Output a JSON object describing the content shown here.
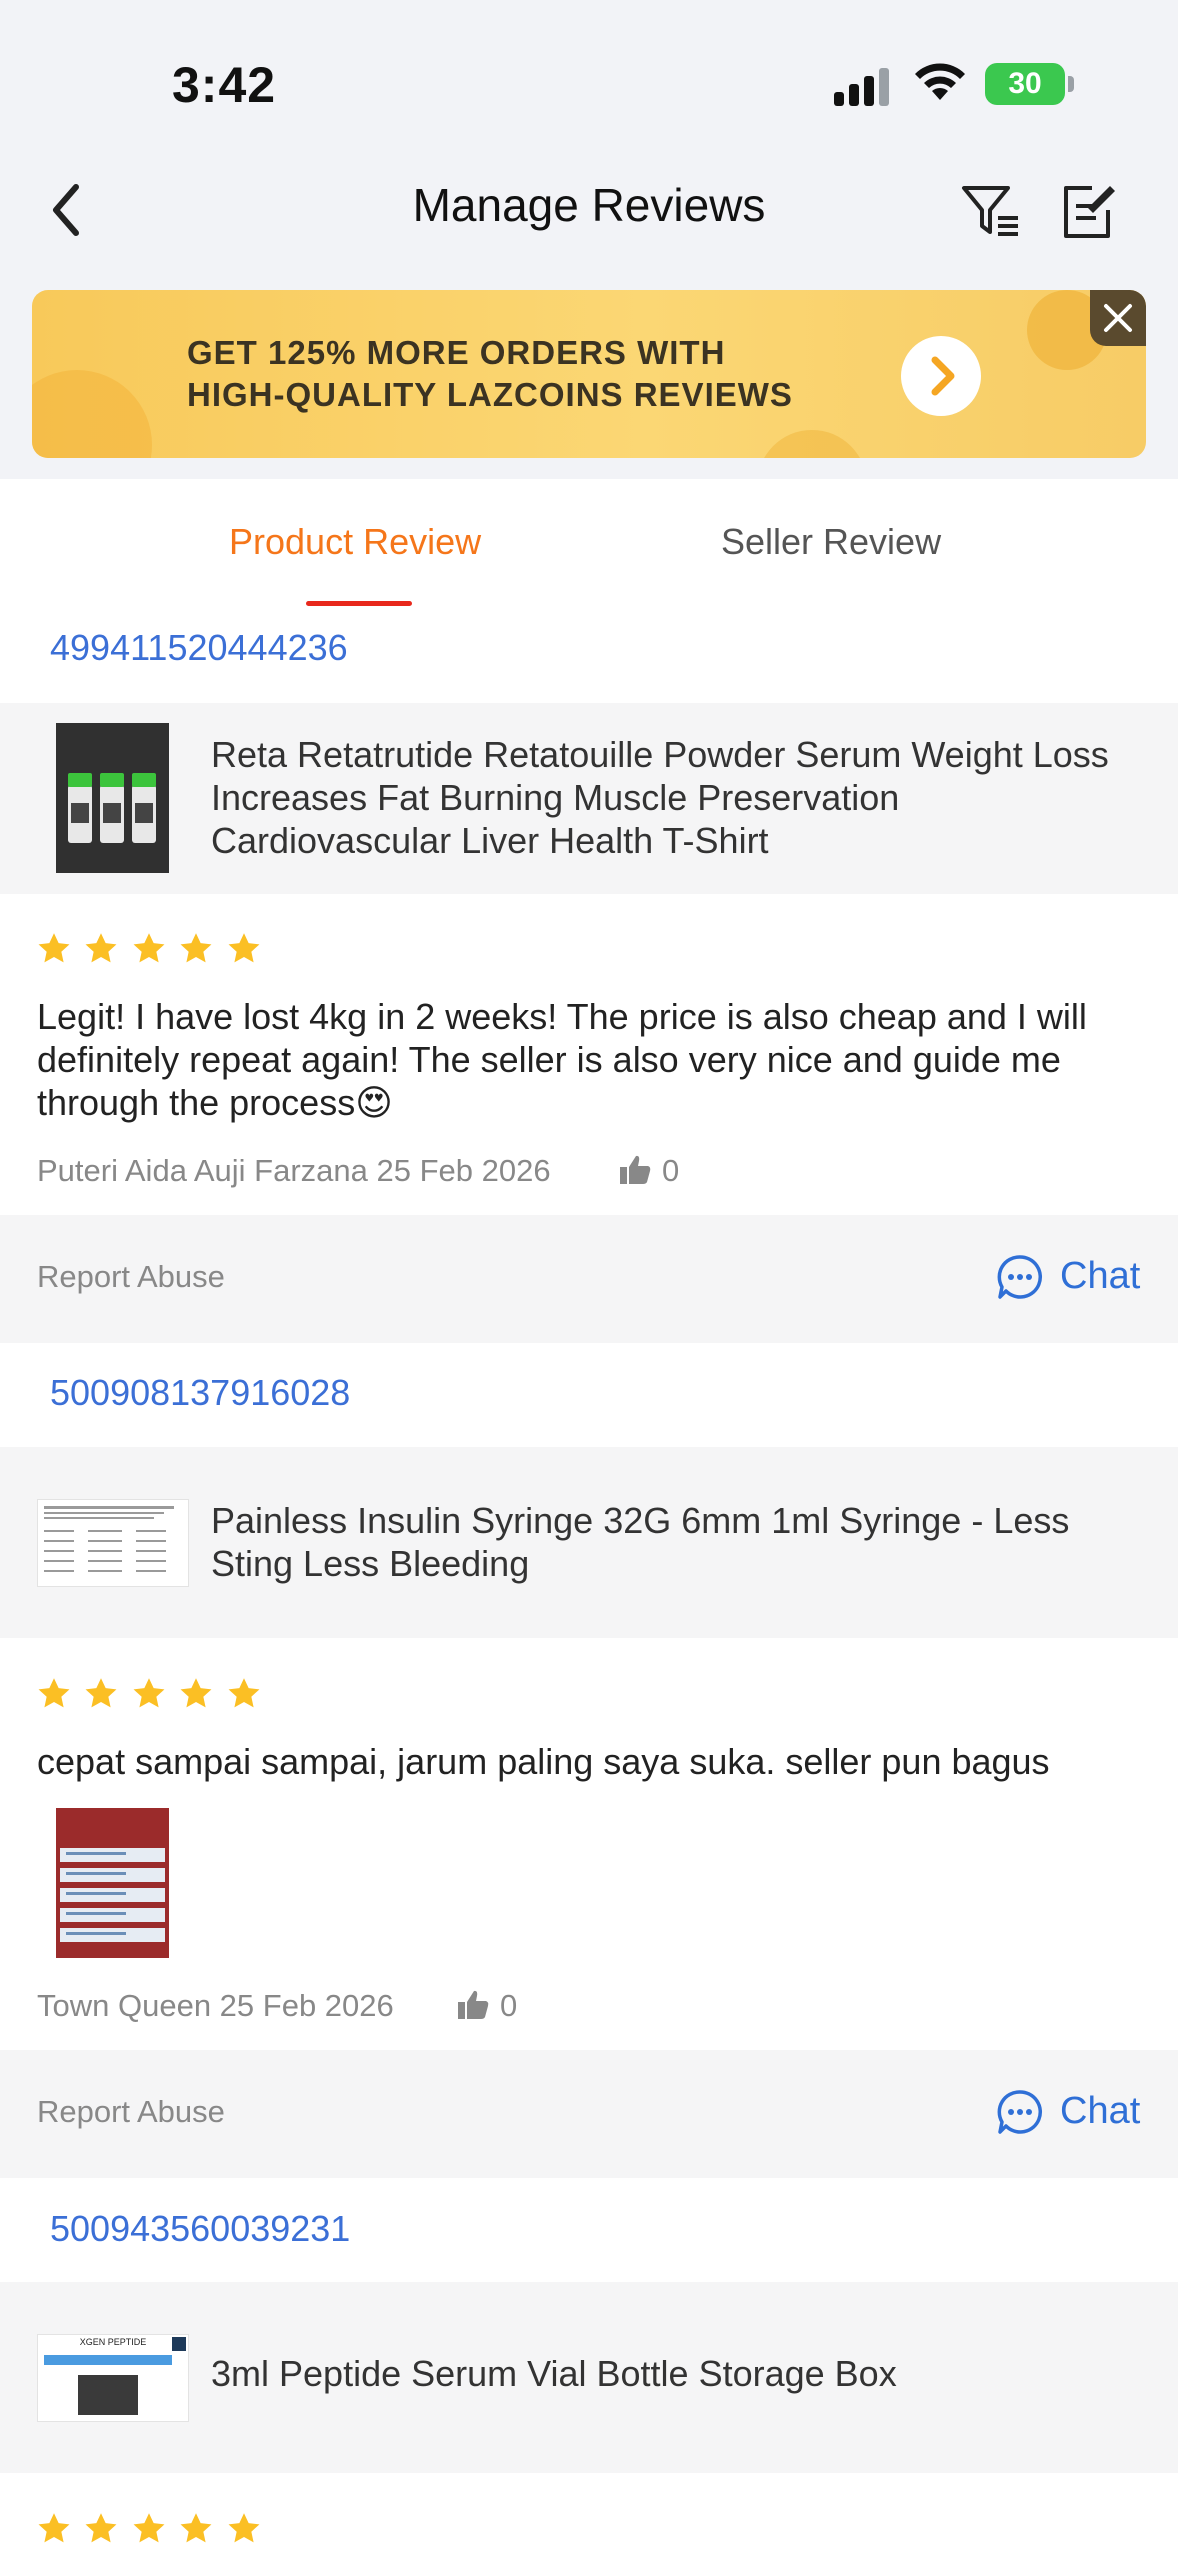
{
  "status_bar": {
    "time": "3:42",
    "battery": "30"
  },
  "header": {
    "title": "Manage Reviews"
  },
  "banner": {
    "line1": "GET 125% MORE ORDERS WITH",
    "line2": "HIGH-QUALITY LAZCOINS REVIEWS"
  },
  "tabs": [
    {
      "label": "Product Review",
      "active": true
    },
    {
      "label": "Seller Review",
      "active": false
    }
  ],
  "colors": {
    "accent": "#f5761a",
    "link": "#3b6fd6",
    "star": "#fbbf24",
    "underline": "#e8281c"
  },
  "reviews": [
    {
      "order_id": "499411520444236",
      "product": "Reta Retatrutide Retatouille Powder Serum Weight Loss Increases Fat Burning Muscle Preservation Cardiovascular Liver Health T-Shirt",
      "rating": 5,
      "text": "Legit! I have lost 4kg in 2 weeks! The price is also cheap and I will definitely repeat again! The seller is also very nice and guide me through the process😍",
      "author_date": "Puteri Aida Auji Farzana 25 Feb 2026",
      "likes": "0",
      "report_label": "Report Abuse",
      "chat_label": "Chat"
    },
    {
      "order_id": "500908137916028",
      "product": "Painless Insulin Syringe 32G 6mm 1ml Syringe - Less Sting Less Bleeding",
      "rating": 5,
      "text": "cepat sampai sampai, jarum paling saya suka. seller pun bagus",
      "author_date": "Town Queen 25 Feb 2026",
      "likes": "0",
      "report_label": "Report Abuse",
      "chat_label": "Chat"
    },
    {
      "order_id": "500943560039231",
      "product": "3ml Peptide Serum Vial Bottle Storage Box",
      "thumb_label": "XGEN PEPTIDE",
      "rating": 5
    }
  ]
}
